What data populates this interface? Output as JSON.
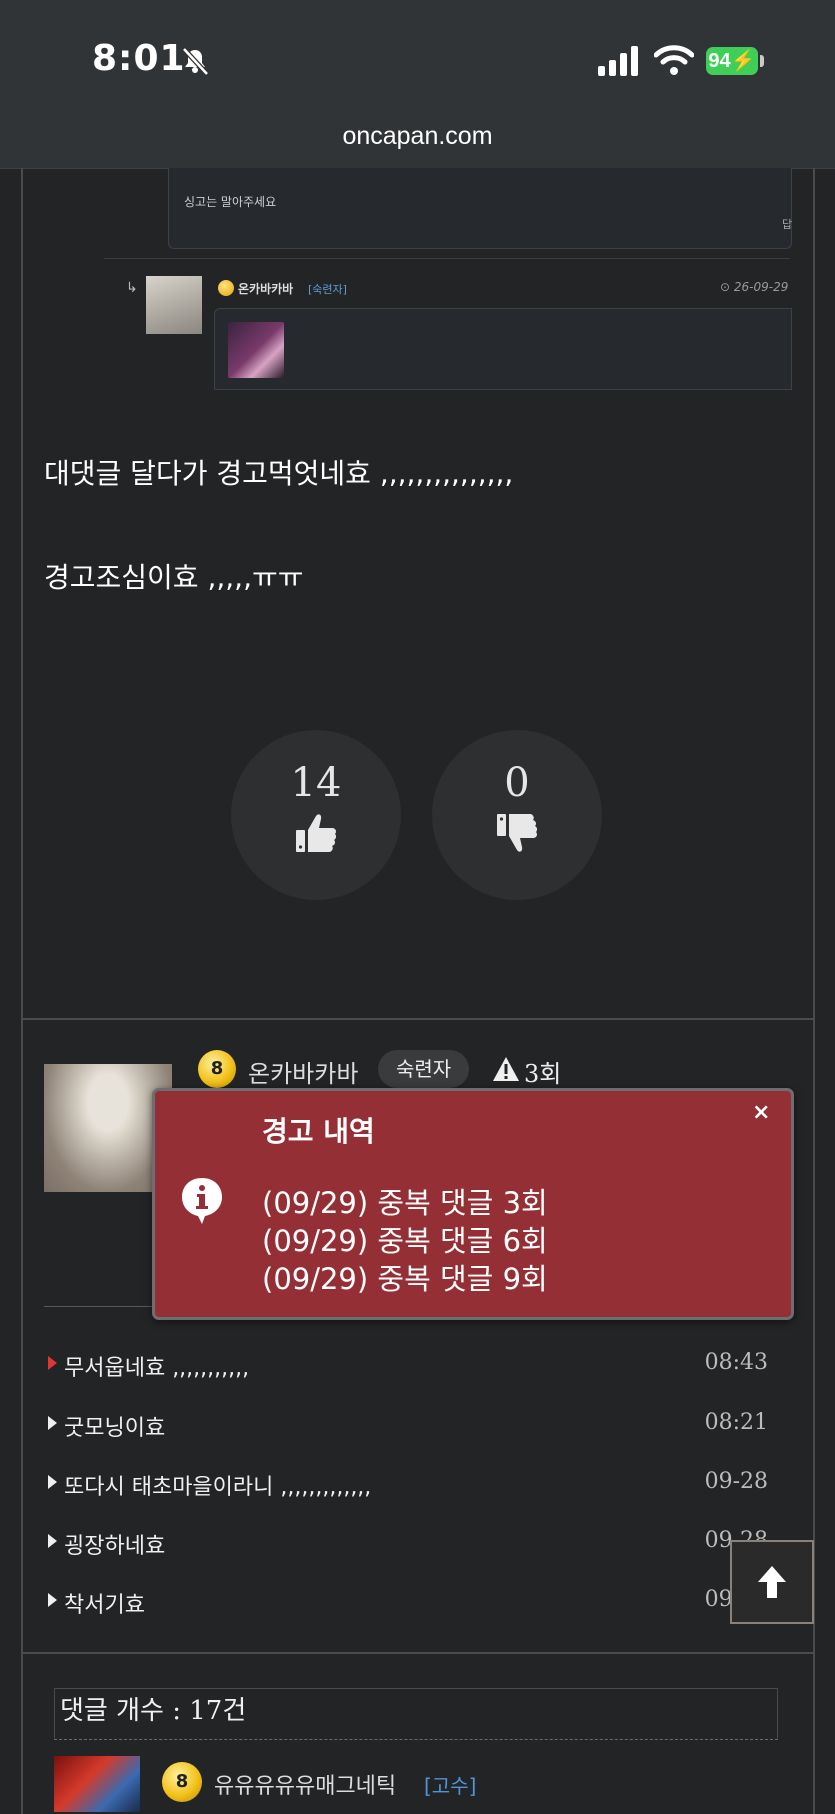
{
  "status_bar": {
    "time": "8:01",
    "battery": "94"
  },
  "browser": {
    "url": "oncapan.com"
  },
  "embedded_comment": {
    "text": "싱고는 말아주세요",
    "side_text": "답"
  },
  "embedded_reply": {
    "nickname": "온카바카바",
    "level": "[숙련자]",
    "date": "26-09-29"
  },
  "post": {
    "paragraphs": [
      "대댓글 달다가 경고먹엇네효 ,,,,,,,,,,,,,,,",
      "경고조심이효 ,,,,,ㅠㅠ"
    ]
  },
  "votes": {
    "up": "14",
    "down": "0"
  },
  "author": {
    "level_num": "8",
    "nickname": "온카바카바",
    "level": "숙련자",
    "warning_count": "3회"
  },
  "warning_popup": {
    "title": "경고 내역",
    "close": "×",
    "lines": [
      "(09/29) 중복 댓글 3회",
      "(09/29) 중복 댓글 6회",
      "(09/29) 중복 댓글 9회"
    ]
  },
  "author_posts": [
    {
      "title": "무서웁네효 ,,,,,,,,,,,",
      "time": "08:43"
    },
    {
      "title": "굿모닝이효",
      "time": "08:21"
    },
    {
      "title": "또다시 태초마을이라니 ,,,,,,,,,,,,,",
      "time": "09-28"
    },
    {
      "title": "굉장하네효",
      "time": "09-28"
    },
    {
      "title": "착서기효",
      "time": "09-28"
    }
  ],
  "comments": {
    "count_label": "댓글 개수 : 17건",
    "first": {
      "level_num": "8",
      "nickname": "유유유유유매그네틱",
      "level": "[고수]"
    }
  },
  "colors": {
    "popup_bg": "#952f36",
    "active_arrow": "#e23535",
    "level_link": "#4f95d8"
  }
}
